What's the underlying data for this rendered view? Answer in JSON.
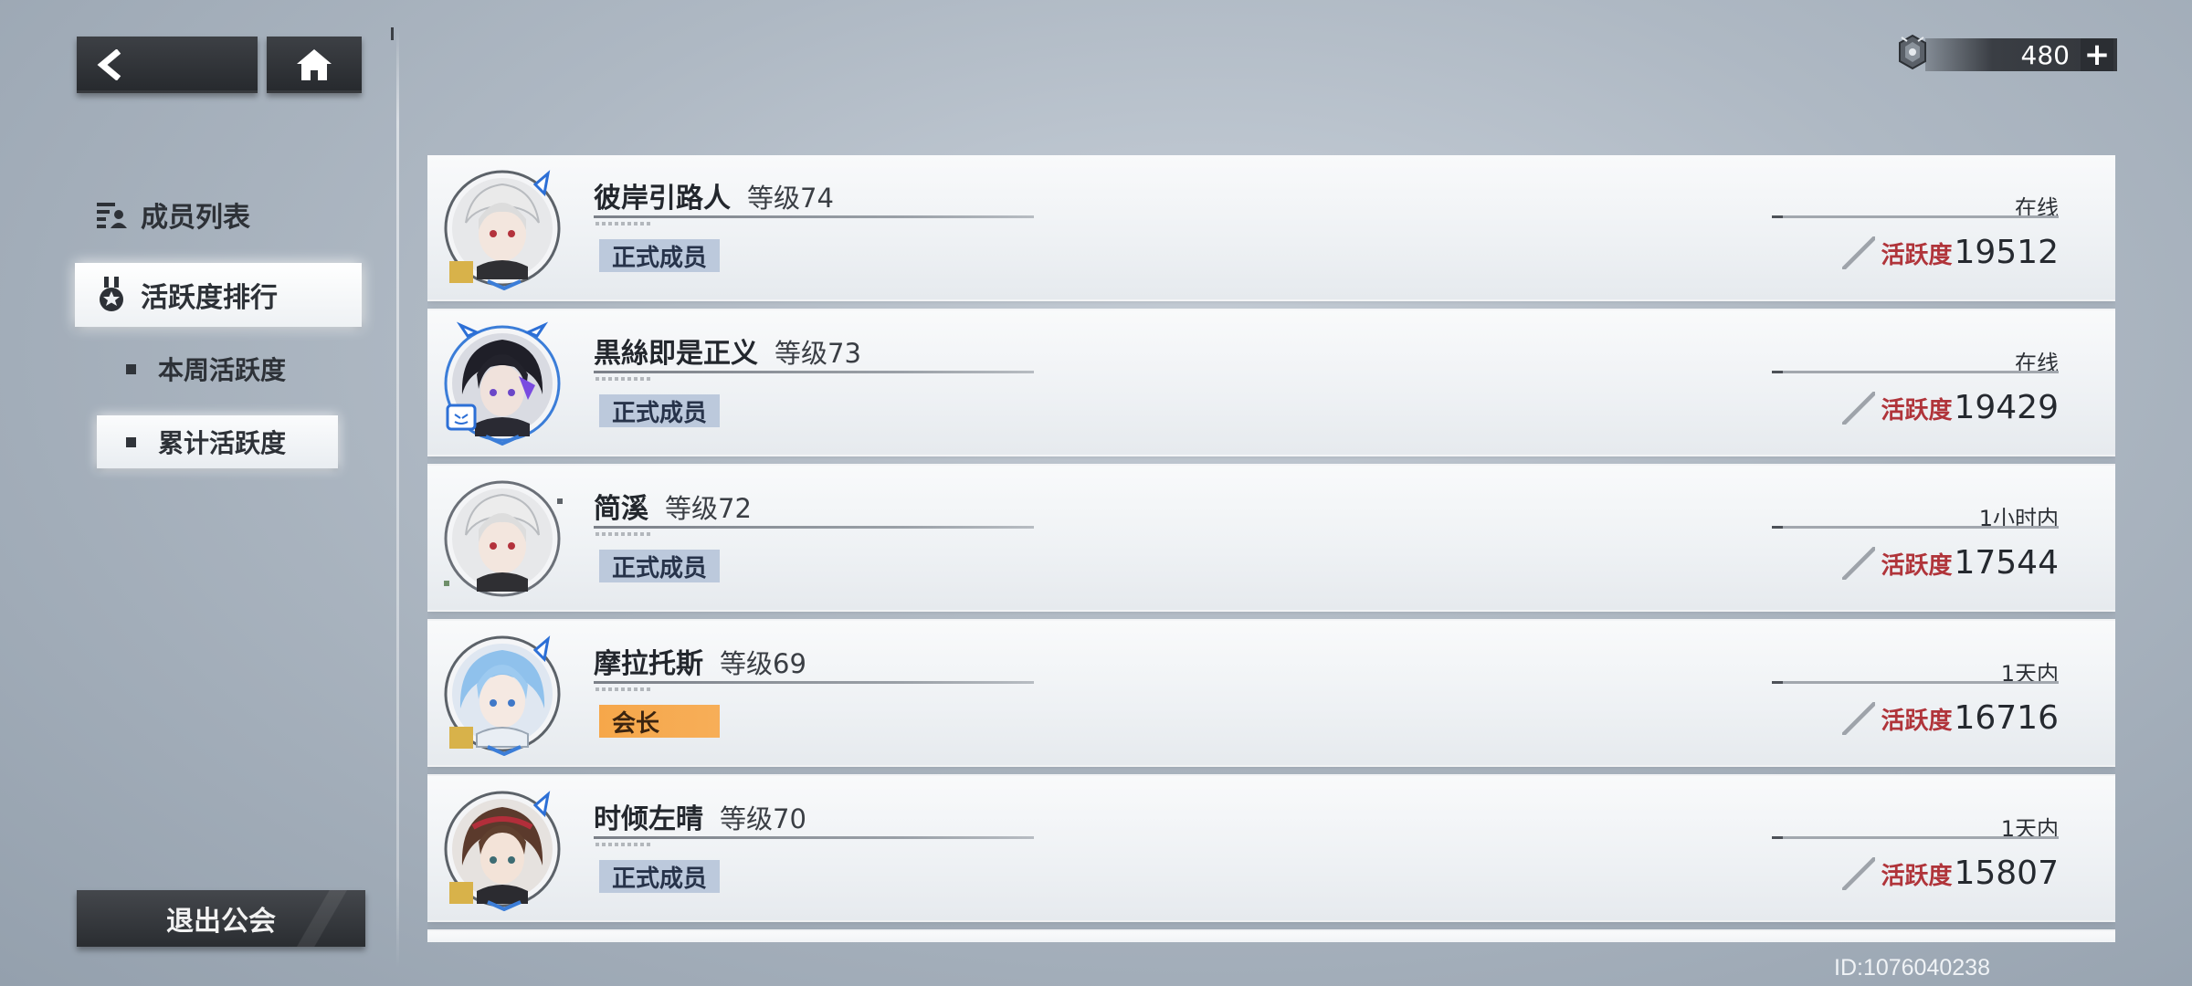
{
  "nav": {
    "back_icon": "back-arrow-icon",
    "home_icon": "home-icon"
  },
  "currency": {
    "icon": "crystal-icon",
    "amount": "480",
    "add_label": "+"
  },
  "menu": {
    "members_label": "成员列表",
    "activity_label": "活跃度排行",
    "week_label": "本周活跃度",
    "total_label": "累计活跃度"
  },
  "leave_label": "退出公会",
  "members": [
    {
      "name": "彼岸引路人",
      "level": "等级74",
      "role": "正式成员",
      "status": "在线",
      "activity_label": "活跃度",
      "activity": "19512"
    },
    {
      "name": "黒絲即是正义",
      "level": "等级73",
      "role": "正式成员",
      "status": "在线",
      "activity_label": "活跃度",
      "activity": "19429"
    },
    {
      "name": "简溪",
      "level": "等级72",
      "role": "正式成员",
      "status": "1小时内",
      "activity_label": "活跃度",
      "activity": "17544"
    },
    {
      "name": "摩拉托斯",
      "level": "等级69",
      "role": "会长",
      "status": "1天内",
      "activity_label": "活跃度",
      "activity": "16716"
    },
    {
      "name": "时倾左晴",
      "level": "等级70",
      "role": "正式成员",
      "status": "1天内",
      "activity_label": "活跃度",
      "activity": "15807"
    }
  ],
  "footer": {
    "id_text": "ID:1076040238"
  },
  "colors": {
    "accent_activity": "#b0343a",
    "role_member": "#bcc9dc",
    "role_leader": "#f6a74a"
  }
}
